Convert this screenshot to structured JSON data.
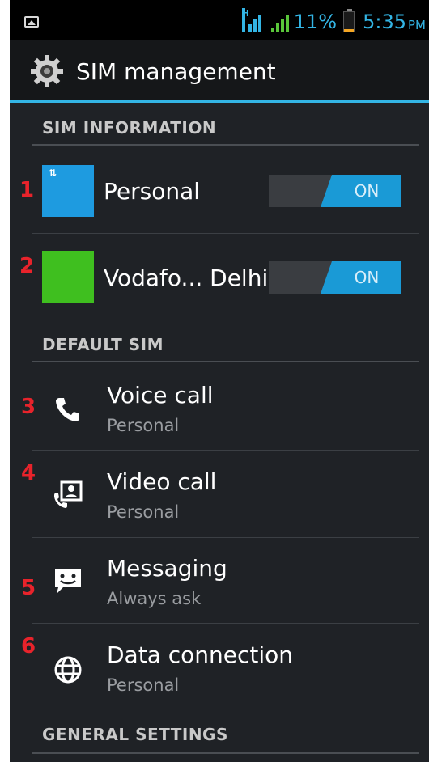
{
  "status_bar": {
    "network_type": "H",
    "battery_percent": "11%",
    "time": "5:35",
    "ampm": "PM",
    "battery_level": 0.11
  },
  "action_bar": {
    "title": "SIM management",
    "icon": "gear-icon"
  },
  "sections": {
    "sim_information": "SIM INFORMATION",
    "default_sim": "DEFAULT SIM",
    "general_settings": "GENERAL SETTINGS"
  },
  "sims": [
    {
      "marker": "1",
      "name": "Personal",
      "color": "#1e9be0",
      "toggle": "ON"
    },
    {
      "marker": "2",
      "name": "Vodafo... Delhi",
      "color": "#3fbf1f",
      "toggle": "ON"
    }
  ],
  "default_items": [
    {
      "marker": "3",
      "title": "Voice call",
      "subtitle": "Personal",
      "icon": "phone-icon"
    },
    {
      "marker": "4",
      "title": "Video call",
      "subtitle": "Personal",
      "icon": "video-call-icon"
    },
    {
      "marker": "5",
      "title": "Messaging",
      "subtitle": "Always ask",
      "icon": "message-icon"
    },
    {
      "marker": "6",
      "title": "Data connection",
      "subtitle": "Personal",
      "icon": "globe-icon"
    }
  ],
  "colors": {
    "accent": "#33b5e5",
    "toggle_on": "#1a9ad6",
    "marker": "#e8232b"
  }
}
